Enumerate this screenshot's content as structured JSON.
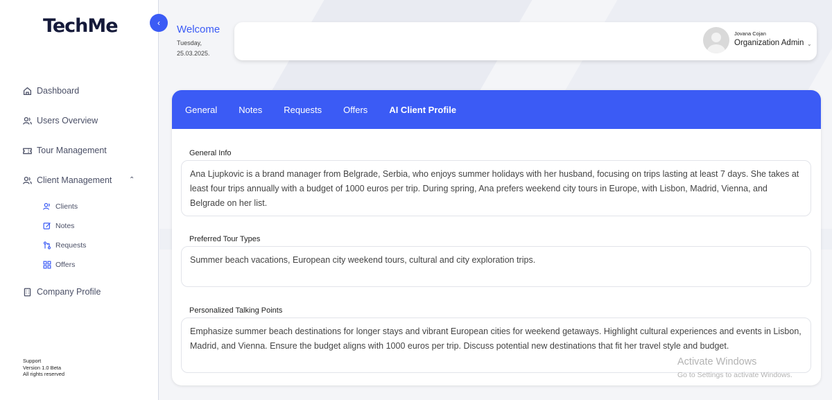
{
  "brand": {
    "logo_text": "TechMe"
  },
  "sidebar": {
    "items": [
      {
        "label": "Dashboard",
        "icon": "home-icon"
      },
      {
        "label": "Users Overview",
        "icon": "user-icon"
      },
      {
        "label": "Tour Management",
        "icon": "ticket-icon"
      },
      {
        "label": "Client Management",
        "icon": "users-icon"
      },
      {
        "label": "Company Profile",
        "icon": "building-icon"
      }
    ],
    "sub_items": [
      {
        "label": "Clients",
        "icon": "users-icon"
      },
      {
        "label": "Notes",
        "icon": "edit-icon"
      },
      {
        "label": "Requests",
        "icon": "requests-icon"
      },
      {
        "label": "Offers",
        "icon": "grid-icon"
      }
    ],
    "footer": {
      "support": "Support",
      "version": "Version 1.0 Beta",
      "rights": "All rights reserved"
    }
  },
  "header": {
    "welcome": "Welcome",
    "day": "Tuesday,",
    "date": "25.03.2025.",
    "user_name": "Jovana Cojan",
    "user_role": "Organization Admin"
  },
  "tabs": [
    {
      "label": "General",
      "active": false
    },
    {
      "label": "Notes",
      "active": false
    },
    {
      "label": "Requests",
      "active": false
    },
    {
      "label": "Offers",
      "active": false
    },
    {
      "label": "AI Client Profile",
      "active": true
    }
  ],
  "profile": {
    "general_info_label": "General Info",
    "general_info_text": "Ana Ljupkovic is a brand manager from Belgrade, Serbia, who enjoys summer holidays with her husband, focusing on trips lasting at least 7 days. She takes at least four trips annually with a budget of 1000 euros per trip. During spring, Ana prefers weekend city tours in Europe, with Lisbon, Madrid, Vienna, and Belgrade on her list.",
    "tour_types_label": "Preferred Tour Types",
    "tour_types_text": "Summer beach vacations, European city weekend tours, cultural and city exploration trips.",
    "talking_points_label": "Personalized Talking Points",
    "talking_points_text": "Emphasize summer beach destinations for longer stays and vibrant European cities for weekend getaways. Highlight cultural experiences and events in Lisbon, Madrid, and Vienna. Ensure the budget aligns with 1000 euros per trip. Discuss potential new destinations that fit her travel style and budget."
  },
  "watermark": {
    "title": "Activate Windows",
    "subtitle": "Go to Settings to activate Windows."
  },
  "colors": {
    "accent": "#3b5bf5",
    "sidebar_bg": "#ffffff",
    "page_bg": "#f4f5f8"
  }
}
